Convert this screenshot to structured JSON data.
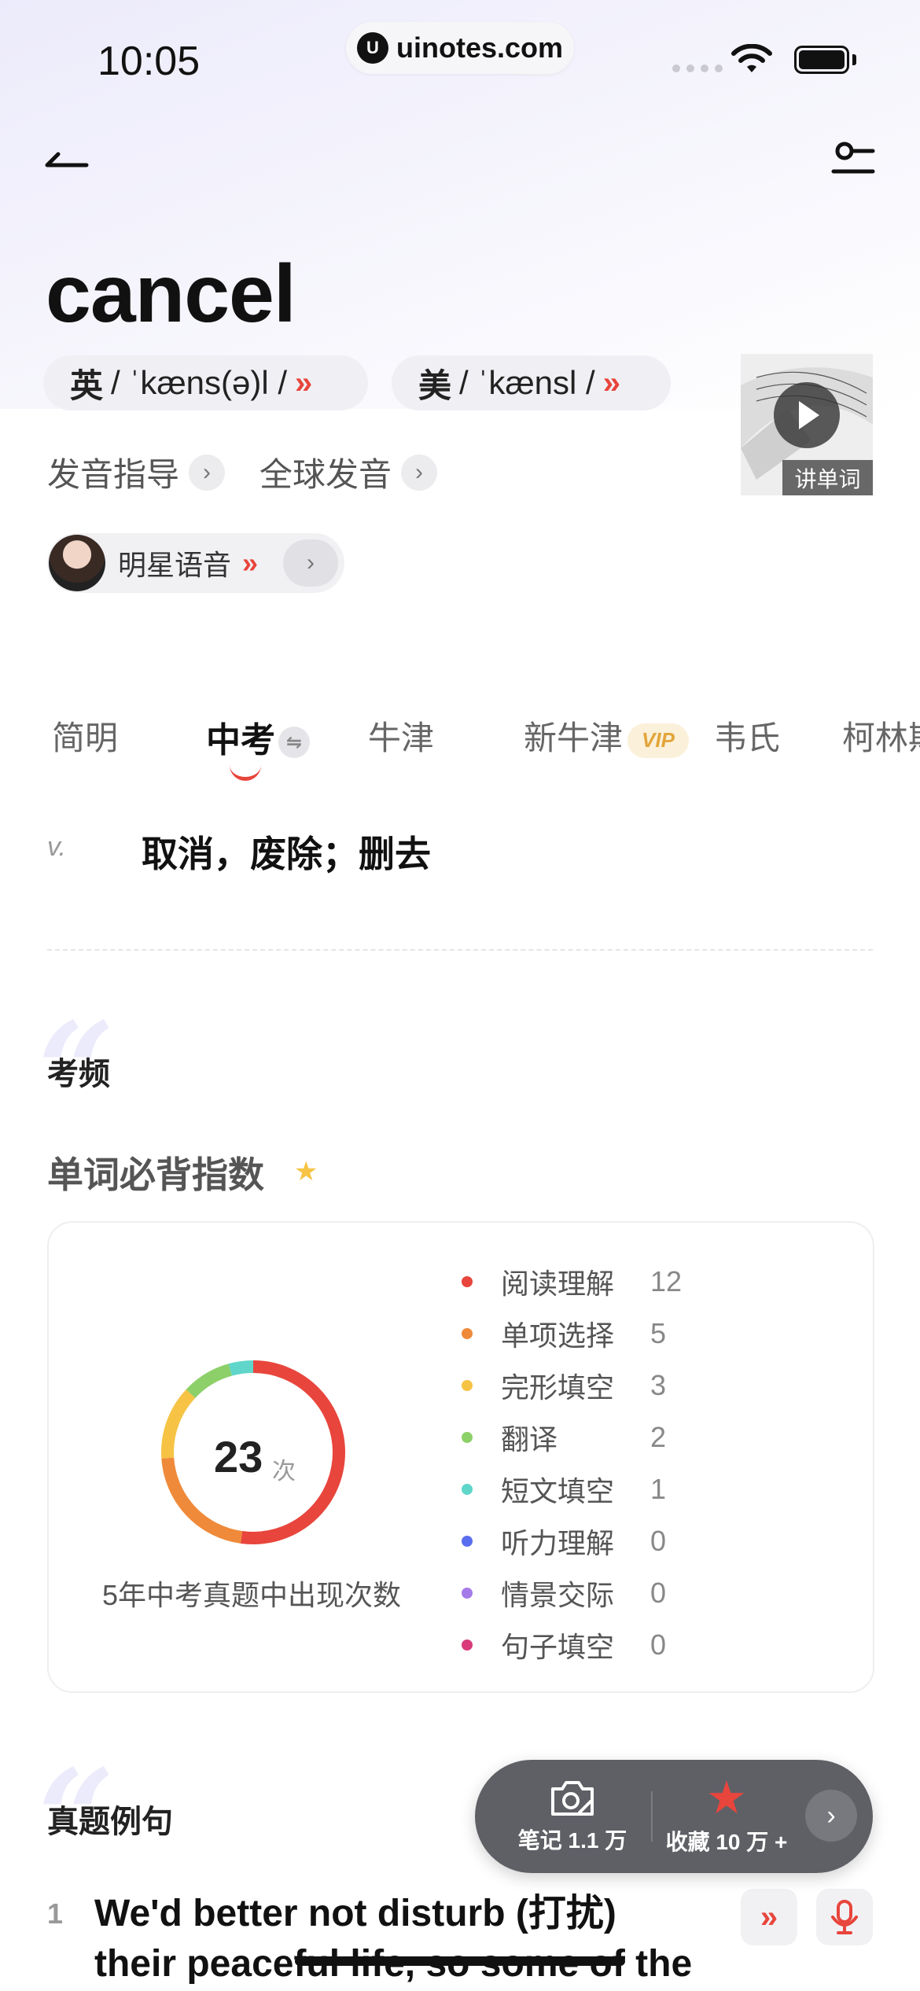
{
  "status_bar": {
    "time": "10:05",
    "url": "uinotes.com",
    "url_logo": "U"
  },
  "header": {
    "word": "cancel"
  },
  "phonetics": {
    "uk": {
      "lang": "英",
      "ipa": "/ ˈkæns(ə)l /"
    },
    "us": {
      "lang": "美",
      "ipa": "/ ˈkænsl /"
    }
  },
  "video": {
    "label": "讲单词"
  },
  "links": {
    "guide": "发音指导",
    "global": "全球发音",
    "star_voice": "明星语音"
  },
  "tabs": [
    {
      "label": "简明"
    },
    {
      "label": "中考",
      "active": true
    },
    {
      "label": "牛津"
    },
    {
      "label": "新牛津",
      "badge": "VIP"
    },
    {
      "label": "韦氏"
    },
    {
      "label": "柯林斯"
    }
  ],
  "definition": {
    "pos": "v.",
    "text": "取消，废除；删去"
  },
  "exam_section": {
    "title": "考频",
    "must_title": "单词必背指数",
    "total": "23",
    "unit": "次",
    "caption": "5年中考真题中出现次数",
    "legend": [
      {
        "label": "阅读理解",
        "value": 12,
        "color": "#e8453c"
      },
      {
        "label": "单项选择",
        "value": 5,
        "color": "#ef8a3a"
      },
      {
        "label": "完形填空",
        "value": 3,
        "color": "#f6c344"
      },
      {
        "label": "翻译",
        "value": 2,
        "color": "#8dd069"
      },
      {
        "label": "短文填空",
        "value": 1,
        "color": "#5fd6c9"
      },
      {
        "label": "听力理解",
        "value": 0,
        "color": "#5a6df0"
      },
      {
        "label": "情景交际",
        "value": 0,
        "color": "#a57be9"
      },
      {
        "label": "句子填空",
        "value": 0,
        "color": "#d93a7a"
      }
    ]
  },
  "examples": {
    "title": "真题例句",
    "items": [
      {
        "num": "1",
        "line1": "We'd better not disturb (打扰)",
        "line2": "their peaceful life, so some of the"
      }
    ]
  },
  "float_bar": {
    "notes": "笔记 1.1 万",
    "favorite": "收藏 10 万 +"
  }
}
